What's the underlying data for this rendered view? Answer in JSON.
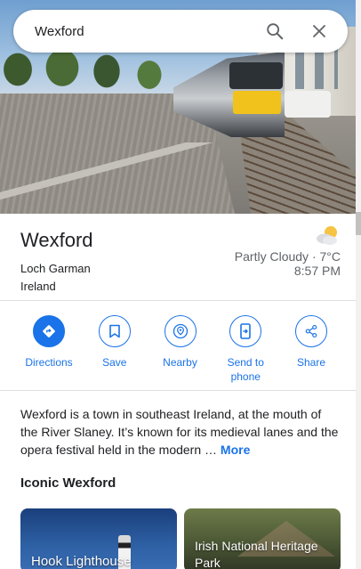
{
  "search": {
    "query": "Wexford",
    "search_icon": "search-icon",
    "close_icon": "close-icon"
  },
  "place": {
    "name": "Wexford",
    "alt_name": "Loch Garman",
    "country": "Ireland"
  },
  "weather": {
    "icon": "partly-cloudy-icon",
    "summary": "Partly Cloudy · 7°C",
    "time": "8:57 PM"
  },
  "actions": [
    {
      "label": "Directions",
      "icon": "directions-icon"
    },
    {
      "label": "Save",
      "icon": "bookmark-icon"
    },
    {
      "label": "Nearby",
      "icon": "nearby-icon"
    },
    {
      "label": "Send to phone",
      "icon": "send-to-phone-icon"
    },
    {
      "label": "Share",
      "icon": "share-icon"
    }
  ],
  "description": {
    "text": "Wexford is a town in southeast Ireland, at the mouth of the River Slaney. It’s known for its medieval lanes and the opera festival held in the modern …",
    "more": "More"
  },
  "iconic": {
    "title": "Iconic Wexford",
    "cards": [
      {
        "label": "Hook Lighthouse"
      },
      {
        "label": "Irish National Heritage Park"
      }
    ]
  },
  "colors": {
    "accent": "#1a73e8",
    "text": "#202124",
    "secondary_text": "#5f6368"
  }
}
